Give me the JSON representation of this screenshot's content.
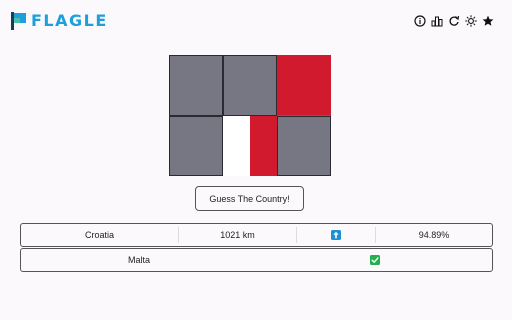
{
  "app": {
    "title": "FLAGLE"
  },
  "header": {
    "icons": [
      "info-icon",
      "stats-icon",
      "reset-icon",
      "theme-icon",
      "star-icon"
    ]
  },
  "flag": {
    "grid_rows": 2,
    "grid_cols": 3,
    "tiles": [
      {
        "row": 0,
        "col": 0,
        "revealed": false
      },
      {
        "row": 0,
        "col": 1,
        "revealed": false
      },
      {
        "row": 0,
        "col": 2,
        "revealed": true,
        "colors": [
          "#d11a2e"
        ]
      },
      {
        "row": 1,
        "col": 0,
        "revealed": false
      },
      {
        "row": 1,
        "col": 1,
        "revealed": true,
        "colors": [
          "#ffffff",
          "#d11a2e"
        ]
      },
      {
        "row": 1,
        "col": 2,
        "revealed": false
      }
    ],
    "hidden_color": "#777683",
    "red": "#d11a2e",
    "white": "#ffffff"
  },
  "guess_button": {
    "label": "Guess The Country!"
  },
  "guesses": [
    {
      "country": "Croatia",
      "distance": "1021 km",
      "direction_icon": "arrow-up-icon",
      "direction_color": "#1e90d6",
      "proximity": "94.89%",
      "correct": false
    },
    {
      "country": "Malta",
      "correct": true,
      "result_icon": "check-icon",
      "result_color": "#22b14c"
    }
  ]
}
